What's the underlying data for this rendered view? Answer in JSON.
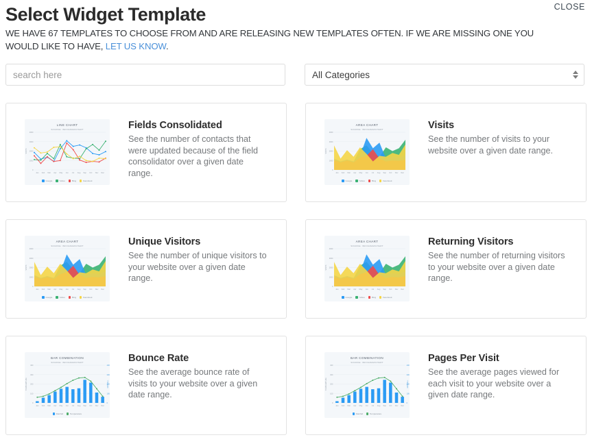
{
  "header": {
    "title": "Select Widget Template",
    "close_label": "CLOSE",
    "subtitle_part1": "WE HAVE 67 TEMPLATES TO CHOOSE FROM AND ARE RELEASING NEW TEMPLATES OFTEN. IF WE ARE MISSING ONE YOU WOULD LIKE TO HAVE, ",
    "subtitle_link": "LET US KNOW",
    "subtitle_part2": ".",
    "template_count": 67
  },
  "filters": {
    "search_placeholder": "search here",
    "search_value": "",
    "category_selected": "All Categories",
    "category_options": [
      "All Categories"
    ]
  },
  "colors": {
    "link": "#4a90d9",
    "card_border": "#e2e2e2",
    "thumb_bg": "#f4f7fa",
    "series_blue": "#2b9bf4",
    "series_green": "#3bb273",
    "series_red": "#ef4b4b",
    "series_yellow": "#f5d547",
    "bar_blue": "#2b9bf4",
    "line_green": "#4fae6b",
    "area_orange": "#f9b233"
  },
  "cards": [
    {
      "title": "Fields Consolidated",
      "description": "See the number of contacts that were updated because of the field consolidator over a given date range.",
      "thumb_type": "line"
    },
    {
      "title": "Visits",
      "description": "See the number of visits to your website over a given date range.",
      "thumb_type": "area"
    },
    {
      "title": "Unique Visitors",
      "description": "See the number of unique visitors to your website over a given date range.",
      "thumb_type": "area"
    },
    {
      "title": "Returning Visitors",
      "description": "See the number of returning visitors to your website over a given date range.",
      "thumb_type": "area"
    },
    {
      "title": "Bounce Rate",
      "description": "See the average bounce rate of visits to your website over a given date range.",
      "thumb_type": "bar"
    },
    {
      "title": "Pages Per Visit",
      "description": "See the average pages viewed for each visit to your website over a given date range.",
      "thumb_type": "bar"
    }
  ],
  "chart_data": [
    {
      "type": "line",
      "title": "LINE CHART",
      "subtitle": "SOURCE: INFOGRAM/CHART",
      "xlabel": "",
      "ylabel": "VISITS",
      "categories": [
        "Jan",
        "Feb",
        "Mar",
        "Apr",
        "May",
        "Jun",
        "Jul",
        "Aug",
        "Sep",
        "Oct",
        "Nov",
        "Dec"
      ],
      "ylim": [
        0,
        4000
      ],
      "yticks": [
        0,
        1000,
        2000,
        3000,
        4000
      ],
      "grid": true,
      "legend_position": "bottom",
      "series": [
        {
          "name": "Google",
          "color": "#2b9bf4",
          "values": [
            1850,
            1150,
            1350,
            900,
            2250,
            3100,
            2500,
            2650,
            2350,
            1750,
            1600,
            1950
          ]
        },
        {
          "name": "Yahoo",
          "color": "#3bb273",
          "values": [
            1100,
            1050,
            1750,
            1200,
            2700,
            1400,
            1250,
            1200,
            2250,
            2700,
            2100,
            3050
          ]
        },
        {
          "name": "Bing",
          "color": "#ef4b4b",
          "values": [
            1500,
            700,
            1400,
            900,
            1000,
            2850,
            2150,
            1050,
            800,
            900,
            850,
            1250
          ]
        },
        {
          "name": "Facebook",
          "color": "#f5d547",
          "values": [
            2350,
            1800,
            1900,
            2400,
            2450,
            1700,
            1200,
            1450,
            1000,
            900,
            1250,
            1200
          ]
        }
      ]
    },
    {
      "type": "area",
      "title": "AREA CHART",
      "subtitle": "SOURCE: INFOGRAM/CHART",
      "xlabel": "",
      "ylabel": "VISITS",
      "categories": [
        "Jan",
        "Feb",
        "Mar",
        "Apr",
        "May",
        "Jun",
        "Jul",
        "Aug",
        "Sep",
        "Oct",
        "Nov",
        "Dec"
      ],
      "ylim": [
        0,
        4000
      ],
      "yticks": [
        0,
        1000,
        2000,
        3000,
        4000
      ],
      "grid": true,
      "legend_position": "bottom",
      "series": [
        {
          "name": "Google",
          "color": "#2b9bf4",
          "values": [
            1200,
            900,
            1100,
            900,
            1500,
            3400,
            2300,
            2900,
            1200,
            1400,
            1300,
            1600
          ]
        },
        {
          "name": "Yahoo",
          "color": "#3bb273",
          "values": [
            1100,
            850,
            1050,
            850,
            2200,
            2600,
            1800,
            1400,
            2400,
            2000,
            2300,
            3200
          ]
        },
        {
          "name": "Bing",
          "color": "#ef4b4b",
          "values": [
            1050,
            800,
            1000,
            800,
            1300,
            1500,
            2200,
            1200,
            900,
            1000,
            950,
            1100
          ]
        },
        {
          "name": "Facebook",
          "color": "#f5d547",
          "values": [
            2600,
            1200,
            2100,
            1400,
            2400,
            1700,
            900,
            1500,
            1400,
            1800,
            1600,
            2700
          ]
        }
      ]
    },
    {
      "type": "bar",
      "title": "BAR COMBINATION",
      "subtitle": "SOURCE: INFOGRAM/CHART",
      "xlabel": "",
      "ylabel": "TEMPERATURE",
      "y2label": "RAINFALL",
      "categories": [
        "Jan",
        "Feb",
        "Mar",
        "Apr",
        "May",
        "Jun",
        "Jul",
        "Aug",
        "Sep",
        "Oct",
        "Nov",
        "Dec"
      ],
      "ylim": [
        0,
        400
      ],
      "yticks": [
        0,
        100,
        200,
        300,
        400
      ],
      "y2ticks": [
        0,
        100,
        200,
        300,
        400
      ],
      "grid": true,
      "legend_position": "bottom",
      "series": [
        {
          "name": "Rainfall",
          "color": "#2b9bf4",
          "type": "bar",
          "values": [
            18,
            55,
            82,
            120,
            150,
            170,
            145,
            155,
            245,
            215,
            110,
            65
          ]
        },
        {
          "name": "Temperature",
          "color": "#4fae6b",
          "type": "line",
          "values": [
            60,
            70,
            95,
            130,
            165,
            205,
            240,
            265,
            270,
            230,
            150,
            70
          ]
        }
      ]
    }
  ]
}
